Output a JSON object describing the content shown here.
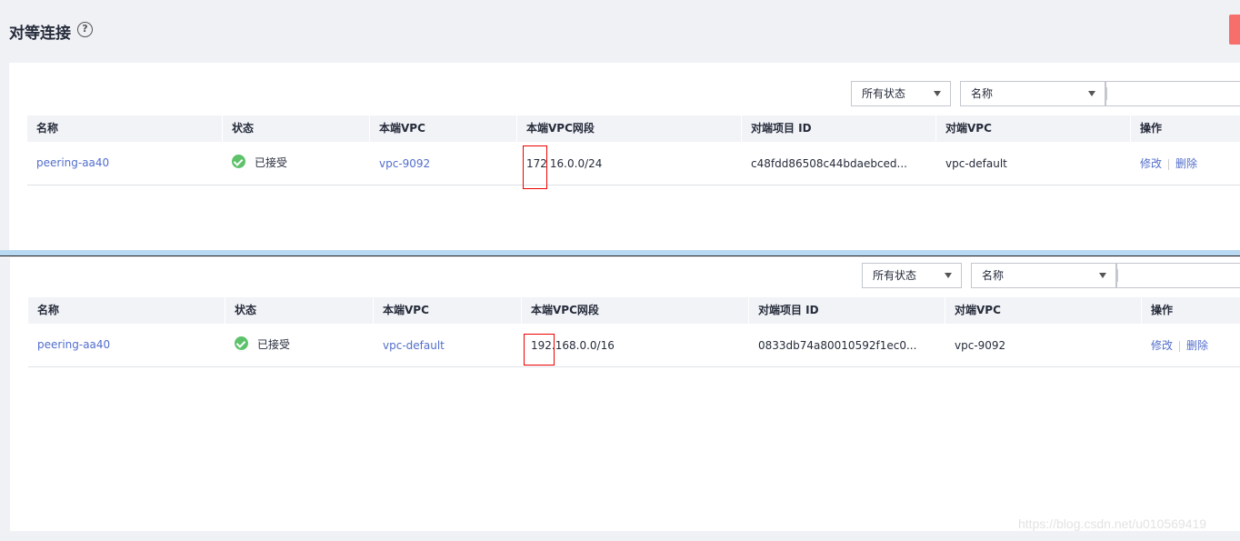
{
  "page": {
    "title": "对等连接",
    "help_icon": "question-circle-icon"
  },
  "filters": {
    "status_label": "所有状态",
    "field_label": "名称"
  },
  "columns": [
    "名称",
    "状态",
    "本端VPC",
    "本端VPC网段",
    "对端项目 ID",
    "对端VPC",
    "操作"
  ],
  "tables": [
    {
      "row": {
        "name": "peering-aa40",
        "status": "已接受",
        "local_vpc": "vpc-9092",
        "cidr_a": "172",
        "cidr_b": "16.0.0/24",
        "peer_project_id": "c48fdd86508c44bdaebced...",
        "peer_vpc": "vpc-default",
        "op_edit": "修改",
        "op_delete": "删除"
      }
    },
    {
      "row": {
        "name": "peering-aa40",
        "status": "已接受",
        "local_vpc": "vpc-default",
        "cidr_a": "192.",
        "cidr_b": "168.0.0/16",
        "peer_project_id": "0833db74a80010592f1ec0...",
        "peer_vpc": "vpc-9092",
        "op_edit": "修改",
        "op_delete": "删除"
      }
    }
  ],
  "watermark": "https://blog.csdn.net/u010569419",
  "colors": {
    "link": "#526ecc",
    "success": "#5dc26a",
    "highlight": "#ee0000",
    "danger_button": "#f66f6a"
  }
}
